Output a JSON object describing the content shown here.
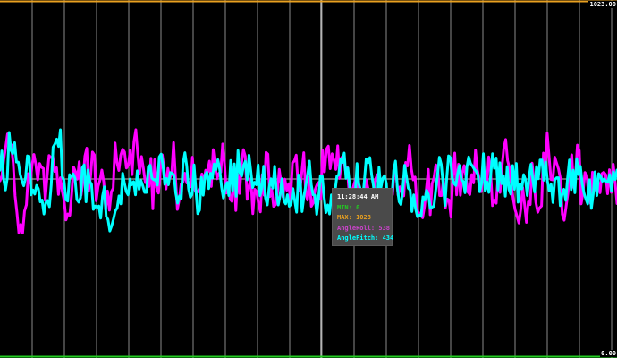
{
  "chart_data": {
    "type": "line",
    "ylim": [
      0,
      1023
    ],
    "ymax_label": "1023.00",
    "ymin_label": "0.00",
    "grid": true,
    "threshold_lines": [
      {
        "name": "MIN",
        "value": 0,
        "color": "#22cc22"
      },
      {
        "name": "MAX",
        "value": 1023,
        "color": "#e8a020"
      }
    ],
    "series": [
      {
        "name": "AngleRoll",
        "color": "#ff00ff",
        "values": [
          506,
          521,
          567,
          602,
          641,
          611,
          610,
          557,
          463,
          414,
          357,
          381,
          356,
          419,
          437,
          527,
          499,
          552,
          582,
          553,
          509,
          556,
          545,
          542,
          450,
          520,
          579,
          573,
          576,
          533,
          544,
          467,
          515,
          477,
          449,
          394,
          411,
          407,
          470,
          546,
          533,
          511,
          561,
          465,
          507,
          577,
          600,
          477,
          518,
          589,
          581,
          449,
          490,
          508,
          537,
          503,
          424,
          477,
          422,
          475,
          485,
          615,
          559,
          536,
          580,
          597,
          589,
          543,
          551,
          595,
          524,
          619,
          653,
          583,
          528,
          576,
          542,
          501,
          502,
          490,
          571,
          426,
          567,
          487,
          471,
          539,
          581,
          538,
          483,
          542,
          514,
          525,
          616,
          517,
          424,
          452,
          497,
          502,
          528,
          500,
          502,
          489,
          574,
          484,
          472,
          476,
          487,
          526,
          505,
          537,
          532,
          563,
          490,
          596,
          550,
          512,
          528,
          531,
          612,
          556,
          471,
          504,
          453,
          447,
          548,
          421,
          525,
          470,
          556,
          596,
          577,
          453,
          490,
          513,
          412,
          482,
          475,
          440,
          417,
          524,
          465,
          588,
          583,
          461,
          482,
          433,
          437,
          469,
          539,
          500,
          460,
          511,
          479,
          498,
          448,
          558,
          563,
          580,
          493,
          477,
          533,
          587,
          471,
          451,
          517,
          433,
          443,
          481,
          495,
          502,
          453,
          593,
          532,
          597,
          606,
          541,
          584,
          566,
          539,
          607,
          513,
          573,
          578,
          537,
          546,
          475,
          412,
          484,
          503,
          518,
          439,
          454,
          478,
          446,
          510,
          486,
          423,
          449,
          473,
          510,
          524,
          461,
          440,
          446,
          435,
          457,
          467,
          458,
          466,
          541,
          523,
          465,
          489,
          472,
          463,
          559,
          549,
          608,
          541,
          509,
          517,
          431,
          404,
          415,
          400,
          433,
          485,
          539,
          409,
          498,
          515,
          552,
          542,
          464,
          464,
          511,
          428,
          454,
          451,
          402,
          521,
          586,
          466,
          554,
          465,
          529,
          550,
          516,
          474,
          467,
          524,
          500,
          594,
          537,
          512,
          475,
          516,
          516,
          491,
          575,
          533,
          435,
          451,
          442,
          528,
          473,
          545,
          600,
          625,
          565,
          543,
          496,
          454,
          423,
          405,
          385,
          424,
          487,
          440,
          387,
          446,
          438,
          557,
          502,
          444,
          416,
          429,
          434,
          586,
          544,
          643,
          575,
          510,
          509,
          574,
          557,
          540,
          513,
          410,
          393,
          432,
          471,
          532,
          581,
          488,
          521,
          609,
          593,
          440,
          474,
          530,
          523,
          462,
          441,
          531,
          480,
          504,
          504,
          472,
          527,
          531,
          524,
          469,
          538,
          473,
          554,
          502,
          441
        ]
      },
      {
        "name": "AnglePitch",
        "color": "#00ffff",
        "values": [
          537,
          592,
          511,
          480,
          515,
          645,
          594,
          584,
          616,
          560,
          560,
          526,
          506,
          492,
          516,
          578,
          575,
          466,
          480,
          468,
          493,
          483,
          446,
          451,
          411,
          443,
          450,
          432,
          495,
          603,
          612,
          626,
          605,
          653,
          518,
          507,
          452,
          448,
          524,
          517,
          526,
          513,
          452,
          445,
          458,
          544,
          552,
          446,
          537,
          505,
          496,
          424,
          434,
          430,
          434,
          399,
          462,
          489,
          404,
          395,
          362,
          377,
          397,
          420,
          428,
          463,
          440,
          528,
          498,
          475,
          466,
          511,
          495,
          504,
          466,
          535,
          482,
          507,
          492,
          473,
          473,
          546,
          551,
          514,
          509,
          510,
          494,
          575,
          583,
          551,
          496,
          513,
          495,
          530,
          528,
          523,
          471,
          442,
          463,
          455,
          556,
          587,
          549,
          483,
          459,
          469,
          552,
          481,
          412,
          422,
          516,
          465,
          523,
          531,
          484,
          528,
          514,
          555,
          538,
          567,
          540,
          489,
          457,
          487,
          501,
          464,
          565,
          479,
          555,
          462,
          593,
          530,
          520,
          549,
          562,
          509,
          580,
          534,
          487,
          502,
          495,
          552,
          464,
          486,
          548,
          457,
          437,
          487,
          512,
          485,
          548,
          472,
          437,
          465,
          512,
          450,
          440,
          466,
          433,
          440,
          484,
          449,
          416,
          523,
          507,
          418,
          462,
          492,
          522,
          563,
          495,
          466,
          465,
          410,
          457,
          521,
          520,
          461,
          415,
          437,
          411,
          466,
          455,
          476,
          520,
          523,
          568,
          559,
          586,
          513,
          543,
          491,
          444,
          476,
          464,
          556,
          497,
          479,
          449,
          505,
          569,
          558,
          573,
          523,
          491,
          423,
          437,
          545,
          485,
          513,
          521,
          499,
          419,
          409,
          454,
          536,
          563,
          487,
          446,
          438,
          482,
          551,
          519,
          485,
          480,
          418,
          466,
          426,
          403,
          408,
          404,
          460,
          451,
          479,
          467,
          427,
          431,
          433,
          479,
          525,
          574,
          554,
          499,
          435,
          514,
          578,
          573,
          514,
          499,
          493,
          528,
          550,
          509,
          505,
          472,
          546,
          575,
          556,
          549,
          540,
          534,
          524,
          475,
          498,
          584,
          478,
          503,
          473,
          522,
          584,
          542,
          572,
          480,
          558,
          498,
          521,
          462,
          547,
          481,
          468,
          550,
          482,
          556,
          445,
          497,
          483,
          524,
          510,
          464,
          518,
          554,
          509,
          474,
          547,
          512,
          566,
          566,
          508,
          560,
          505,
          477,
          496,
          444,
          509,
          515,
          515,
          435,
          467,
          482,
          450,
          514,
          566,
          481,
          537,
          472,
          570,
          524,
          548,
          497,
          470,
          454,
          440,
          509,
          427,
          468,
          532,
          464,
          527,
          519,
          505,
          512,
          505,
          502,
          524,
          478,
          532,
          510,
          537
        ]
      }
    ]
  },
  "tooltip": {
    "time": "11:28:44 AM",
    "min_label": "MIN: 0",
    "max_label": "MAX: 1023",
    "roll_label": "AngleRoll: 538",
    "pitch_label": "AnglePitch: 434"
  }
}
